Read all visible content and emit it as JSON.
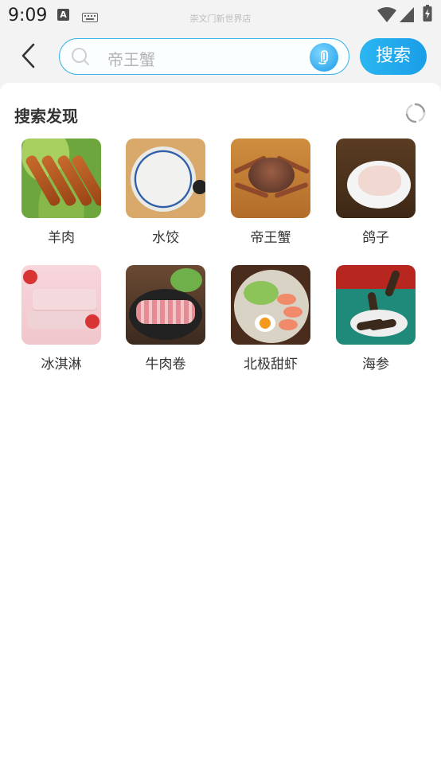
{
  "status_bar": {
    "time": "9:09",
    "carrier_text": "崇文门新世界店",
    "notification_icon_letter": "A",
    "icons": [
      "a-notification-icon",
      "keyboard-icon",
      "wifi-icon",
      "signal-icon",
      "battery-icon"
    ]
  },
  "search": {
    "placeholder": "帝王蟹",
    "submit_label": "搜索",
    "accent_color": "#1fa6ec"
  },
  "discover": {
    "title": "搜索发现",
    "items": [
      {
        "label": "羊肉"
      },
      {
        "label": "水饺"
      },
      {
        "label": "帝王蟹"
      },
      {
        "label": "鸽子"
      },
      {
        "label": "冰淇淋"
      },
      {
        "label": "牛肉卷"
      },
      {
        "label": "北极甜虾"
      },
      {
        "label": "海参"
      }
    ]
  }
}
